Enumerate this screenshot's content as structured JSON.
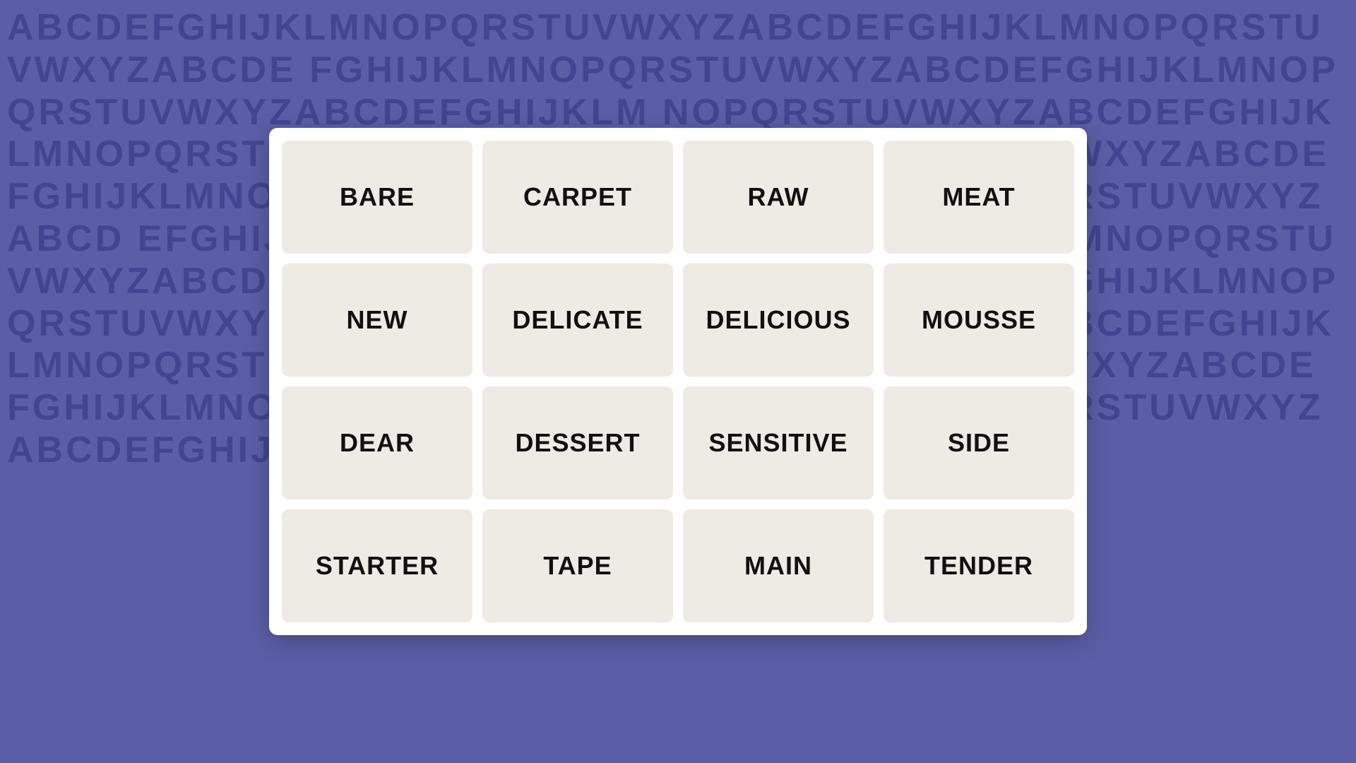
{
  "background": {
    "color": "#5b5ea6",
    "alphabet_text": "ABCDEFGHIJKLMNOPQRSTUVWXYZABCDEFGHIJKLMNOPQRSTUVWXYZABCDEFGHIJKLMNOPQRSTUVWXYZABCDEFGHIJKLMNOPQRSTUVWXYZABCDEFGHIJKLMNOPQRSTUVWXYZABCDEFGHIJKLMNOPQRSTUVWXYZABCDEFGHIJKLMNOPQRSTUVWXYZABCDEFGHIJKLMNOPQRSTUVWXYZABCDEFGHIJKLMNOPQRSTUVWXYZABCDEFGHIJKLMNOPQRSTUVWXYZABCDEFGHIJKLMNOPQRSTUVWXYZABCDEFGHIJKLMNOPQRSTUVWXYZABCDEFGHIJKLMNOPQRSTUVWXYZABCDEFGHIJKLMNOPQRSTUVWXYZABCDEFGHIJKLMNOPQRSTUVWXYZABCDEFGHIJKLMNOPQRSTUVWXYZ"
  },
  "grid": {
    "words": [
      "BARE",
      "CARPET",
      "RAW",
      "MEAT",
      "NEW",
      "DELICATE",
      "DELICIOUS",
      "MOUSSE",
      "DEAR",
      "DESSERT",
      "SENSITIVE",
      "SIDE",
      "STARTER",
      "TAPE",
      "MAIN",
      "TENDER"
    ]
  }
}
